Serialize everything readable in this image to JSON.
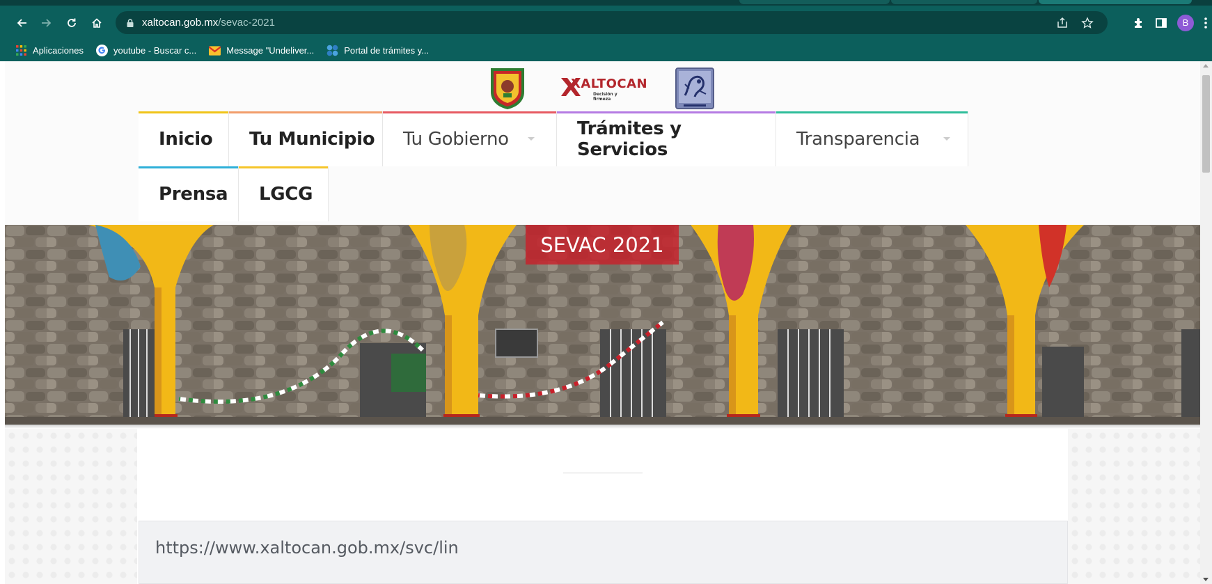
{
  "browser": {
    "url_host": "xaltocan.gob.mx",
    "url_path": "/sevac-2021",
    "profile_initial": "B",
    "bookmarks": [
      {
        "label": "Aplicaciones",
        "icon": "apps-grid-icon"
      },
      {
        "label": "youtube - Buscar c...",
        "icon": "google-icon"
      },
      {
        "label": "Message \"Undeliver...",
        "icon": "gmail-icon"
      },
      {
        "label": "Portal de trámites y...",
        "icon": "portal-icon"
      }
    ]
  },
  "site": {
    "logo_text": "XALTOCAN",
    "logo_tagline": "Decisión y firmeza",
    "menu": [
      {
        "label": "Inicio"
      },
      {
        "label": "Tu Municipio"
      },
      {
        "label": "Tu Gobierno"
      },
      {
        "label": "Trámites y Servicios"
      },
      {
        "label": "Transparencia"
      },
      {
        "label": "Prensa"
      },
      {
        "label": "LGCG"
      }
    ],
    "hero_title": "SEVAC 2021",
    "content_link": "https://www.xaltocan.gob.mx/svc/lin"
  },
  "colors": {
    "browser_toolbar": "#0c5f5c",
    "menu_inicio": "#f0c419",
    "menu_municipio": "#f29d6b",
    "menu_gobierno": "#e75a62",
    "menu_tramites": "#b57be3",
    "menu_transparencia": "#2ebd9a",
    "menu_prensa": "#2fb0d8",
    "menu_lgcg": "#f5c52b",
    "hero_title_bg": "#c8202a"
  }
}
